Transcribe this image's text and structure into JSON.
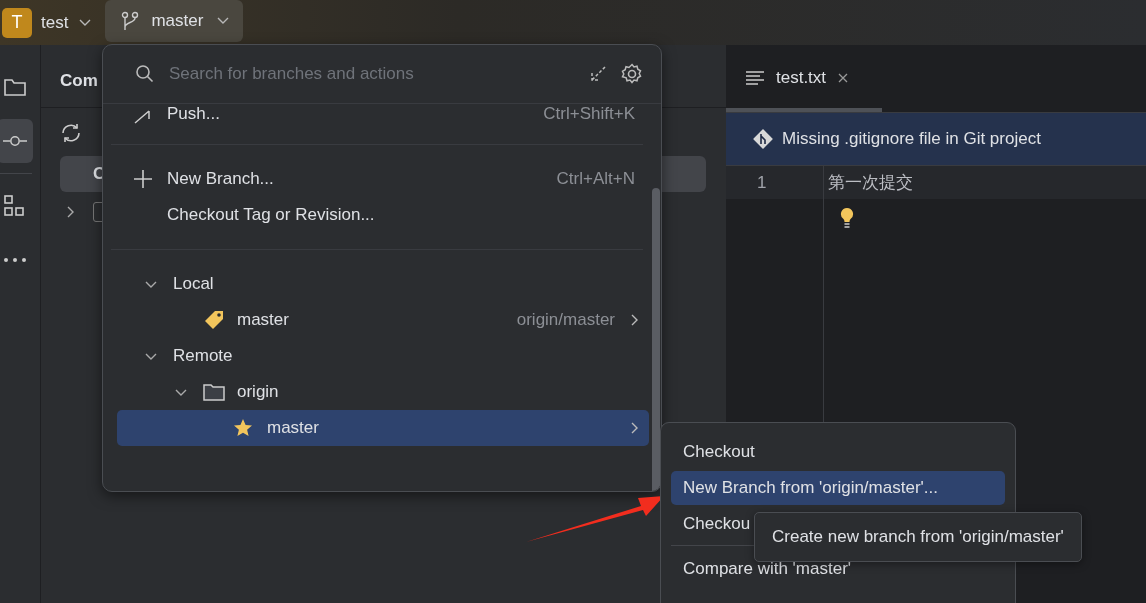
{
  "project": {
    "initial": "T",
    "name": "test"
  },
  "branch_widget": {
    "name": "master"
  },
  "tool_strip": [
    {
      "kind": "folder",
      "selected": false
    },
    {
      "kind": "commit",
      "selected": true
    },
    {
      "kind": "structure",
      "selected": false
    },
    {
      "kind": "more",
      "selected": false
    }
  ],
  "commit_panel": {
    "title": "Com",
    "button": "C",
    "checked": false
  },
  "branch_popup": {
    "search": {
      "placeholder": "Search for branches and actions"
    },
    "action_groups": [
      [
        {
          "kind": "push",
          "label": "Push...",
          "shortcut": "Ctrl+Shift+K"
        }
      ],
      [
        {
          "kind": "add",
          "label": "New Branch...",
          "shortcut": "Ctrl+Alt+N"
        },
        {
          "kind": "plain",
          "label": "Checkout Tag or Revision..."
        }
      ]
    ],
    "tree": [
      {
        "kind": "group",
        "label": "Local",
        "expanded": true,
        "children": [
          {
            "kind": "branch",
            "label": "master",
            "current": true,
            "tracking": "origin/master",
            "selected": false
          }
        ]
      },
      {
        "kind": "group",
        "label": "Remote",
        "expanded": true,
        "children": [
          {
            "kind": "folder",
            "label": "origin",
            "expanded": true,
            "children": [
              {
                "kind": "branch",
                "label": "master",
                "current": false,
                "favorite": true,
                "selected": true
              }
            ]
          }
        ]
      }
    ]
  },
  "editor": {
    "tabs": [
      {
        "label": "test.txt",
        "selected": true
      }
    ],
    "banner": "Missing .gitignore file in Git project",
    "lines": [
      {
        "number": "1",
        "text": "第一次提交"
      }
    ]
  },
  "context_menu": {
    "groups": [
      [
        {
          "label": "Checkout",
          "selected": false
        },
        {
          "label": "New Branch from 'origin/master'...",
          "selected": true
        },
        {
          "label": "Checkou",
          "selected": false
        }
      ],
      [
        {
          "label": "Compare with 'master'",
          "selected": false
        }
      ]
    ]
  },
  "tooltip": "Create new branch from 'origin/master'"
}
